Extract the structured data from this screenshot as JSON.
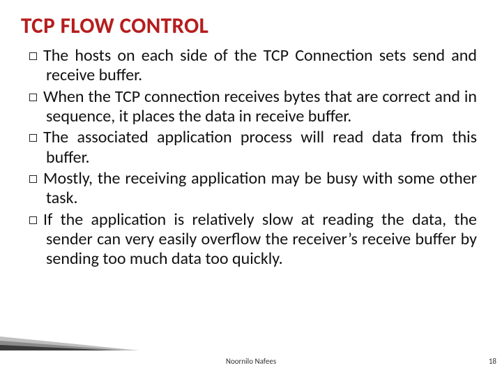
{
  "title": "TCP FLOW CONTROL",
  "bullets": [
    "The hosts on each side of the TCP Connection sets send and receive buffer.",
    "When the TCP connection receives bytes that are correct and in sequence, it places the data in receive buffer.",
    "The associated application process will read data from this buffer.",
    "Mostly, the receiving application may be busy with some other task.",
    "If the application is relatively slow at reading the data, the sender can very easily overflow the receiver’s receive buffer by sending too much data too quickly."
  ],
  "footer": {
    "author": "Noornilo Nafees",
    "page": "18"
  },
  "colors": {
    "title": "#b71c1c"
  }
}
